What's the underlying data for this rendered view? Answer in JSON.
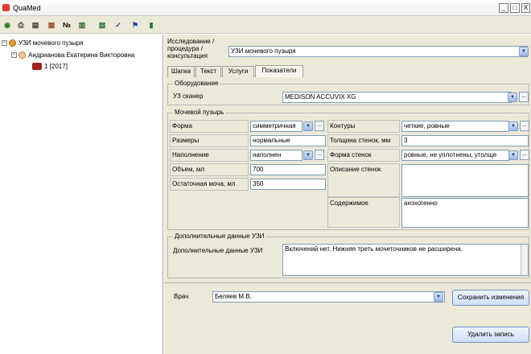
{
  "app": {
    "title": "QuaMed"
  },
  "window": {
    "minimize": "_",
    "maximize": "□",
    "close": "X"
  },
  "toolbar": {
    "items": [
      {
        "icon": "globe-icon",
        "glyph": "◉"
      },
      {
        "icon": "print-icon",
        "glyph": "⎙"
      },
      {
        "icon": "doc-print-icon",
        "glyph": "▤"
      },
      {
        "icon": "folder-icon",
        "glyph": "▦"
      },
      {
        "icon": "number-icon",
        "glyph": "№"
      },
      {
        "icon": "cards-icon",
        "glyph": "▥"
      },
      {
        "icon": "cards2-icon",
        "glyph": "▧"
      },
      {
        "icon": "check-icon",
        "glyph": "✓"
      },
      {
        "icon": "flag-check-icon",
        "glyph": "⚑"
      },
      {
        "icon": "exit-icon",
        "glyph": "▮"
      }
    ]
  },
  "tree": {
    "root": "УЗИ мочевого пузыря",
    "patient": "Андрианова Екатерина Викторовна",
    "record": "1 [2017]",
    "root_toggle": "−",
    "patient_toggle": "−"
  },
  "header": {
    "study_label": "Исследование / процедура / консультация",
    "study_value": "УЗИ мочевого пузыря"
  },
  "tabs": [
    {
      "label": "Шапка"
    },
    {
      "label": "Текст"
    },
    {
      "label": "Услуги"
    },
    {
      "label": "Показатели"
    }
  ],
  "equipment": {
    "title": "Оборудование",
    "scanner_label": "УЗ сканер",
    "scanner_value": "MEDISON ACCUVIX XG"
  },
  "bladder": {
    "title": "Мочевой пузырь",
    "form_label": "Форма",
    "form_value": "симметричная",
    "size_label": "Размеры",
    "size_value": "нормальные",
    "fill_label": "Наполнение",
    "fill_value": "наполнен",
    "volume_label": "Объем, мл",
    "volume_value": "700",
    "residual_label": "Остаточная моча, мл",
    "residual_value": "350",
    "contours_label": "Контуры",
    "contours_value": "четкие, ровные",
    "wall_thickness_label": "Толщина стенок, мм",
    "wall_thickness_value": "3",
    "wall_form_label": "Форма стенок",
    "wall_form_value": "ровные, не уплотнены, утолще",
    "wall_desc_label": "Описание стенок",
    "wall_desc_value": "",
    "contents_label": "Содержимое",
    "contents_value": "анэхогенно"
  },
  "extra": {
    "title": "Дополнительные данные УЗИ",
    "label": "Дополнительные данные УЗИ",
    "value": "Включений нет. Нижняя треть мочеточников не расширена."
  },
  "footer": {
    "doctor_label": "Врач",
    "doctor_value": "Беляев М.В.",
    "save_button": "Сохранить изменения",
    "delete_button": "Удалить запись"
  },
  "controls": {
    "dropdown_glyph": "▼",
    "ellipsis_glyph": "..."
  }
}
